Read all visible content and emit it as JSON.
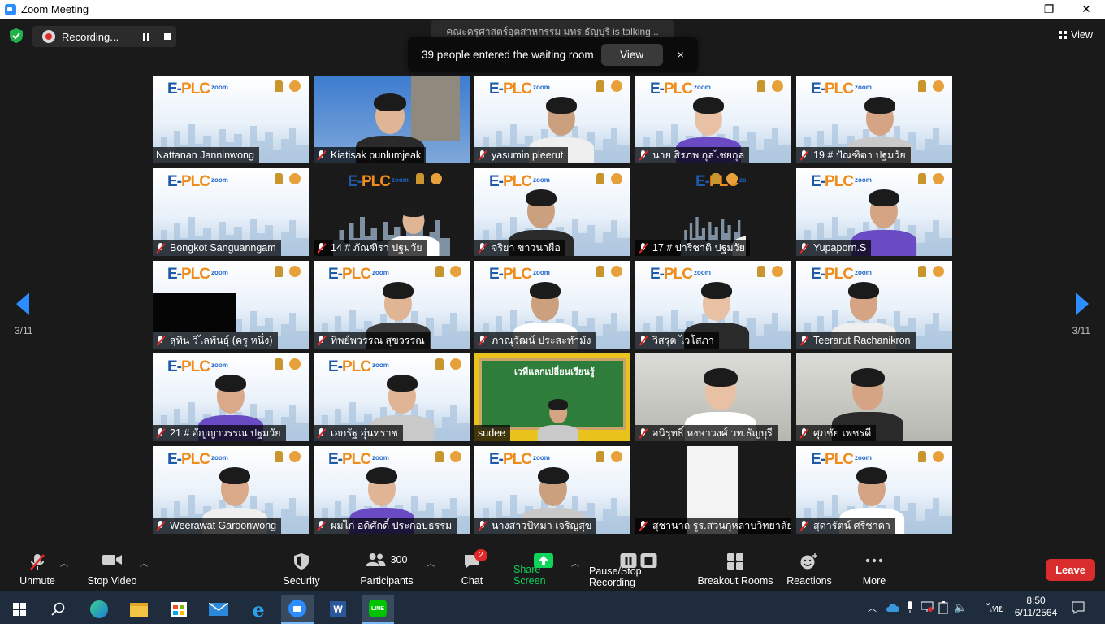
{
  "window": {
    "title": "Zoom Meeting",
    "minimize": "—",
    "maximize": "❐",
    "close": "✕"
  },
  "recording": {
    "label": "Recording..."
  },
  "talking_banner": "คณะครุศาสตร์อุตสาหกรรม มทร.ธัญบุรี is talking...",
  "waiting_room": {
    "message": "39 people entered the waiting room",
    "view_label": "View",
    "close": "×"
  },
  "view_toggle": {
    "label": "View"
  },
  "pagination": {
    "left": "3/11",
    "right": "3/11"
  },
  "tiles": [
    {
      "name": "Nattanan Janninwong",
      "muted": false
    },
    {
      "name": "Kiatisak punlumjeak",
      "muted": true
    },
    {
      "name": "yasumin pleerut",
      "muted": true
    },
    {
      "name": "นาย สิรภพ กุลไชยกุล",
      "muted": true
    },
    {
      "name": "19 # ปัณฑิตา ปฐมวัย",
      "muted": true
    },
    {
      "name": "Bongkot Sanguanngam",
      "muted": true
    },
    {
      "name": "14 # ภัณฑิรา ปฐมวัย",
      "muted": true
    },
    {
      "name": "จริยา ขาวนาผือ",
      "muted": true
    },
    {
      "name": "17 # ปาริชาติ ปฐมวัย",
      "muted": true
    },
    {
      "name": "Yupaporn.S",
      "muted": true
    },
    {
      "name": "สุทิน วิไลพันธุ์ (ครู หนึ่ง)",
      "muted": true
    },
    {
      "name": "ทิพย์พวรรณ สุขวรรณ",
      "muted": true
    },
    {
      "name": "ภาณุวัฒน์ ประสะทำมัง",
      "muted": true
    },
    {
      "name": "วิสรุต ไวโสภา",
      "muted": true
    },
    {
      "name": "Teerarut Rachanikron",
      "muted": true
    },
    {
      "name": "21 # อัญญาวรรณ ปฐมวัย",
      "muted": true
    },
    {
      "name": "เอกรัฐ อุ่นทราช",
      "muted": true
    },
    {
      "name": "sudee",
      "muted": false
    },
    {
      "name": "อนิรุทธิ์ หงษาวงศ์ วท.ธัญบุรี",
      "muted": true
    },
    {
      "name": "ศุภชัย เพชรดี",
      "muted": true
    },
    {
      "name": "Weerawat Garoonwong",
      "muted": true
    },
    {
      "name": "ผมไก่ อดิศักดิ์ ประกอบธรรม",
      "muted": true
    },
    {
      "name": "นางสาวปัทมา เจริญสุข",
      "muted": true
    },
    {
      "name": "สุชานาถ รูร.สวนกุหลาบวิทยาลัย...",
      "muted": true
    },
    {
      "name": "สุดารัตน์ ศรีชาดา",
      "muted": true
    }
  ],
  "slide": {
    "eplc": "PLC",
    "e": "E-",
    "zoom": "zoom",
    "board_text": "เวทีแลกเปลี่ยนเรียนรู้"
  },
  "toolbar": {
    "unmute": "Unmute",
    "stop_video": "Stop Video",
    "security": "Security",
    "participants": "Participants",
    "participants_count": "300",
    "chat": "Chat",
    "chat_badge": "2",
    "share_screen": "Share Screen",
    "pause_recording": "Pause/Stop Recording",
    "breakout": "Breakout Rooms",
    "reactions": "Reactions",
    "more": "More",
    "leave": "Leave"
  },
  "taskbar": {
    "lang": "ไทย",
    "time": "8:50",
    "date": "6/11/2564"
  }
}
